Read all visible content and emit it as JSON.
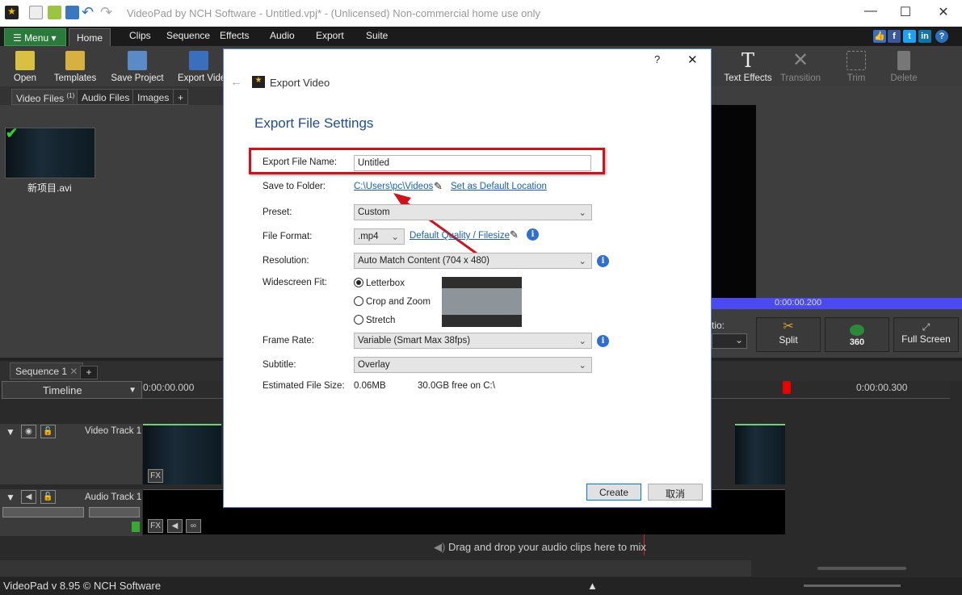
{
  "window": {
    "title": "VideoPad by NCH Software - Untitled.vpj* - (Unlicensed) Non-commercial home use only",
    "minimize": "—",
    "maximize": "☐",
    "close": "✕"
  },
  "menubar": {
    "menu": "Menu",
    "tabs": [
      "Home",
      "Clips",
      "Sequence",
      "Effects",
      "Audio",
      "Export",
      "Suite"
    ]
  },
  "toolbar": {
    "items": [
      "Open",
      "Templates",
      "Save Project",
      "Export Video",
      "Text Effects",
      "Transition",
      "Trim",
      "Delete"
    ]
  },
  "left_panel": {
    "tabs": [
      "Video Files",
      "Audio Files",
      "Images",
      "+"
    ],
    "video_files_count": "(1)",
    "file": "新项目.avi"
  },
  "preview": {
    "time": "0:00:00.200",
    "ratio_label": "tio:",
    "split": "Split",
    "vr": "360",
    "fullscreen": "Full Screen"
  },
  "sequence": {
    "tab": "Sequence 1",
    "add": "+",
    "timeline_label": "Timeline",
    "time_start": "0:00:00.000",
    "time_end": "0:00:00.300",
    "video_track": "Video Track 1",
    "audio_track": "Audio Track 1",
    "fx": "FX",
    "drop_hint": "Drag and drop your audio clips here to mix"
  },
  "status": {
    "text": "VideoPad v 8.95 © NCH Software"
  },
  "dialog": {
    "title": "Export Video",
    "help": "?",
    "close": "✕",
    "heading": "Export File Settings",
    "file_name_label": "Export File Name:",
    "file_name": "Untitled",
    "folder_label": "Save to Folder:",
    "folder": "C:\\Users\\pc\\Videos",
    "set_default": "Set as Default Location",
    "preset_label": "Preset:",
    "preset": "Custom",
    "format_label": "File Format:",
    "format": ".mp4",
    "quality_link": "Default Quality / Filesize",
    "resolution_label": "Resolution:",
    "resolution": "Auto Match Content (704 x 480)",
    "widescreen_label": "Widescreen Fit:",
    "widescreen_options": [
      "Letterbox",
      "Crop and Zoom",
      "Stretch"
    ],
    "widescreen_selected": "Letterbox",
    "framerate_label": "Frame Rate:",
    "framerate": "Variable (Smart Max 38fps)",
    "subtitle_label": "Subtitle:",
    "subtitle": "Overlay",
    "size_label": "Estimated File Size:",
    "size": "0.06MB",
    "free": "30.0GB free on C:\\",
    "create": "Create",
    "cancel": "取消"
  },
  "colors": {
    "highlight": "#d0121b",
    "accent_green": "#2a7a3c",
    "link": "#1a5fb4",
    "timeline_bar": "#4a4af0"
  }
}
